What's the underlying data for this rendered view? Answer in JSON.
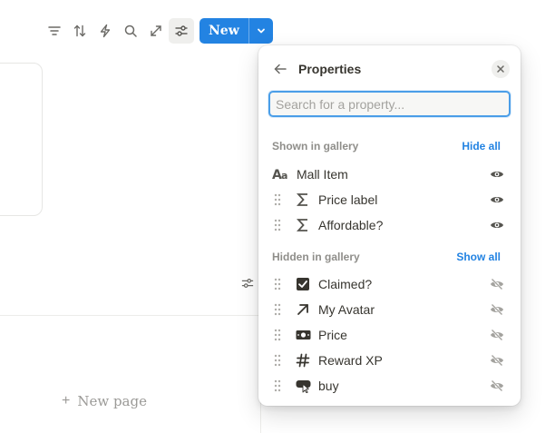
{
  "toolbar": {
    "icons": [
      "filter-icon",
      "sort-icon",
      "automation-icon",
      "search-icon",
      "expand-icon",
      "settings-icon"
    ],
    "new_label": "New"
  },
  "board": {
    "new_page_label": "New page"
  },
  "panel": {
    "title": "Properties",
    "search_placeholder": "Search for a property...",
    "shown": {
      "title": "Shown in gallery",
      "action": "Hide all",
      "items": [
        {
          "label": "Mall Item",
          "icon": "title-icon",
          "visible": true
        },
        {
          "label": "Price label",
          "icon": "formula-icon",
          "visible": true
        },
        {
          "label": "Affordable?",
          "icon": "formula-icon",
          "visible": true
        }
      ]
    },
    "hidden": {
      "title": "Hidden in gallery",
      "action": "Show all",
      "items": [
        {
          "label": "Claimed?",
          "icon": "checkbox-icon",
          "visible": false
        },
        {
          "label": "My Avatar",
          "icon": "relation-arrow-icon",
          "visible": false
        },
        {
          "label": "Price",
          "icon": "currency-icon",
          "visible": false
        },
        {
          "label": "Reward XP",
          "icon": "number-icon",
          "visible": false
        },
        {
          "label": "buy",
          "icon": "button-icon",
          "visible": false
        }
      ]
    }
  },
  "colors": {
    "accent": "#2383e2",
    "text": "#37352f",
    "muted": "#8f8e8a"
  }
}
